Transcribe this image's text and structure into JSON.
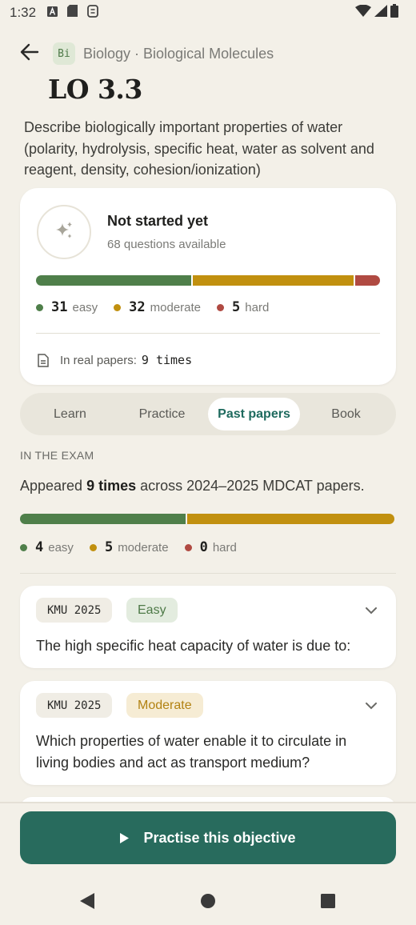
{
  "status_bar": {
    "time": "1:32"
  },
  "header": {
    "subject_badge": "Bi",
    "breadcrumb": "Biology · Biological Molecules"
  },
  "objective": {
    "code": "LO 3.3",
    "description": "Describe biologically important properties of water (polarity, hydrolysis, specific heat, water as solvent and reagent, density, cohesion/ionization)"
  },
  "status_card": {
    "status": "Not started yet",
    "questions_available": "68 questions available",
    "distribution": {
      "easy": 31,
      "moderate": 32,
      "hard": 5
    },
    "labels": {
      "easy": "easy",
      "moderate": "moderate",
      "hard": "hard"
    },
    "easy_count": "31",
    "moderate_count": "32",
    "hard_count": "5",
    "real_papers_label": "In real papers:",
    "real_papers_count": "9 times"
  },
  "tabs": [
    {
      "label": "Learn",
      "active": false
    },
    {
      "label": "Practice",
      "active": false
    },
    {
      "label": "Past papers",
      "active": true
    },
    {
      "label": "Book",
      "active": false
    }
  ],
  "exam": {
    "section_label": "IN THE EXAM",
    "appeared_prefix": "Appeared ",
    "appeared_times": "9 times",
    "appeared_suffix": " across 2024–2025 MDCAT papers.",
    "distribution": {
      "easy": 4,
      "moderate": 5,
      "hard": 0
    },
    "easy_count": "4",
    "moderate_count": "5",
    "hard_count": "0",
    "labels": {
      "easy": "easy",
      "moderate": "moderate",
      "hard": "hard"
    }
  },
  "questions": [
    {
      "paper": "KMU 2025",
      "difficulty": "Easy",
      "text": "The high specific heat capacity of water is due to:"
    },
    {
      "paper": "KMU 2025",
      "difficulty": "Moderate",
      "text": "Which properties of water enable it to circulate in living bodies and act as transport medium?"
    }
  ],
  "cta": {
    "label": "Practise this objective"
  },
  "colors": {
    "easy": "#4f7f4a",
    "moderate": "#c1900f",
    "hard": "#b04a42",
    "accent": "#286b5d",
    "background": "#f3f0e8"
  },
  "icons": {
    "back": "arrow-left-icon",
    "sparkle": "sparkle-icon",
    "document": "document-icon",
    "expand": "chevron-down-icon",
    "play": "play-icon"
  }
}
